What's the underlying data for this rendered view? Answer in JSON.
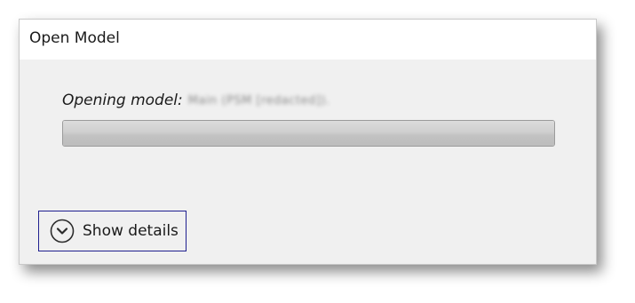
{
  "dialog": {
    "title": "Open Model",
    "status_label": "Opening model:",
    "status_value": "Main (PSM [redacted]).",
    "progress": 1.0,
    "details_button_label": "Show details"
  },
  "icons": {
    "details_toggle": "chevron-down-icon"
  }
}
